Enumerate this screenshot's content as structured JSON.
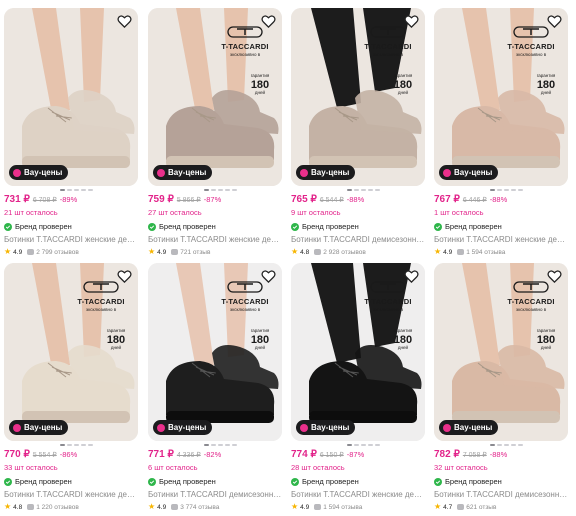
{
  "colors": {
    "accent": "#e2238a",
    "brand_ok": "#2fb64b",
    "badge_bg": "#1c1c1e",
    "star": "#f7b500"
  },
  "badge_text": "Вау-цены",
  "verified_text": "Бренд проверен",
  "logo": {
    "brand": "T-TACCARDI",
    "exclusive": "эксклюзивно в",
    "guarantee_label": "гарантия",
    "guarantee_days": "180",
    "guarantee_unit": "дней"
  },
  "products": [
    {
      "price": "731 ₽",
      "old_price": "6 708 ₽",
      "discount": "-89%",
      "stock": "21 шт осталось",
      "title": "Ботинки T.TACCARDI женские демисезонные",
      "rating": "4.9",
      "reviews": "2 799 отзывов",
      "shoe_color": "#ded2c5",
      "has_logo": false
    },
    {
      "price": "759 ₽",
      "old_price": "5 866 ₽",
      "discount": "-87%",
      "stock": "27 шт осталось",
      "title": "Ботинки T.TACCARDI женские демисезонные",
      "rating": "4.9",
      "reviews": "721 отзыв",
      "shoe_color": "#b5a298",
      "has_logo": true
    },
    {
      "price": "765 ₽",
      "old_price": "6 544 ₽",
      "discount": "-88%",
      "stock": "9 шт осталось",
      "title": "Ботинки T.TACCARDI демисезонные",
      "rating": "4.8",
      "reviews": "2 928 отзывов",
      "shoe_color": "#c4b2a5",
      "has_logo": true
    },
    {
      "price": "767 ₽",
      "old_price": "6 446 ₽",
      "discount": "-88%",
      "stock": "1 шт осталось",
      "title": "Ботинки T.TACCARDI женские демисезонные",
      "rating": "4.9",
      "reviews": "1 594 отзыва",
      "shoe_color": "#d8b9a7",
      "has_logo": true
    },
    {
      "price": "770 ₽",
      "old_price": "5 554 ₽",
      "discount": "-86%",
      "stock": "33 шт осталось",
      "title": "Ботинки T.TACCARDI женские демисезонные",
      "rating": "4.8",
      "reviews": "1 220 отзывов",
      "shoe_color": "#e6dccd",
      "has_logo": true
    },
    {
      "price": "771 ₽",
      "old_price": "4 336 ₽",
      "discount": "-82%",
      "stock": "6 шт осталось",
      "title": "Ботинки T.TACCARDI демисезонные",
      "rating": "4.9",
      "reviews": "3 774 отзыва",
      "shoe_color": "#1e1e1e",
      "has_logo": true
    },
    {
      "price": "774 ₽",
      "old_price": "6 150 ₽",
      "discount": "-87%",
      "stock": "28 шт осталось",
      "title": "Ботинки T.TACCARDI женские демисезонные",
      "rating": "4.9",
      "reviews": "1 594 отзыва",
      "shoe_color": "#141414",
      "has_logo": true
    },
    {
      "price": "782 ₽",
      "old_price": "7 058 ₽",
      "discount": "-88%",
      "stock": "32 шт осталось",
      "title": "Ботинки T.TACCARDI демисезонные",
      "rating": "4.7",
      "reviews": "621 отзыв",
      "shoe_color": "#d9b9a5",
      "has_logo": true
    }
  ]
}
